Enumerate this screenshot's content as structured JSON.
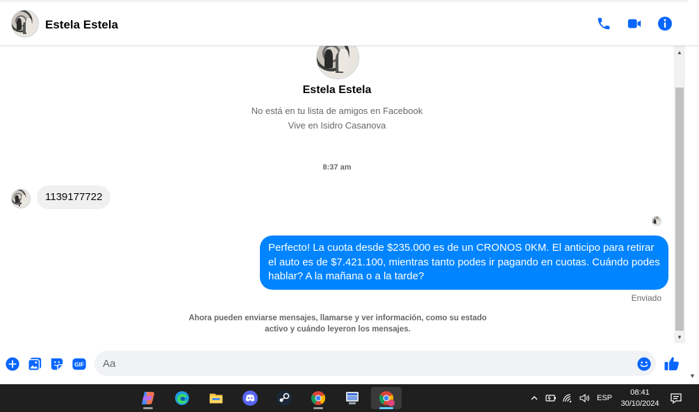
{
  "header": {
    "contact_name": "Estela Estela"
  },
  "profile": {
    "name": "Estela Estela",
    "line1": "No está en tu lista de amigos en Facebook",
    "line2": "Vive en Isidro Casanova"
  },
  "conversation": {
    "timestamp": "8:37 am",
    "incoming_message": "1139177722",
    "outgoing_message": "Perfecto! La cuota desde $235.000 es de un CRONOS 0KM. El anticipo para retirar el auto es de $7.421.100, mientras tanto podes ir pagando en cuotas. Cuándo podes hablar? A la mañana o a la tarde?",
    "status": "Enviado",
    "notice": "Ahora pueden enviarse mensajes, llamarse y ver información, como su estado activo y cuándo leyeron los mensajes."
  },
  "composer": {
    "placeholder": "Aa"
  },
  "taskbar": {
    "language": "ESP",
    "time": "08:41",
    "date": "30/10/2024"
  },
  "colors": {
    "accent": "#0084ff",
    "icon_blue": "#0866ff",
    "incoming_bubble": "#f0f0f0",
    "secondary_text": "#65676b"
  }
}
